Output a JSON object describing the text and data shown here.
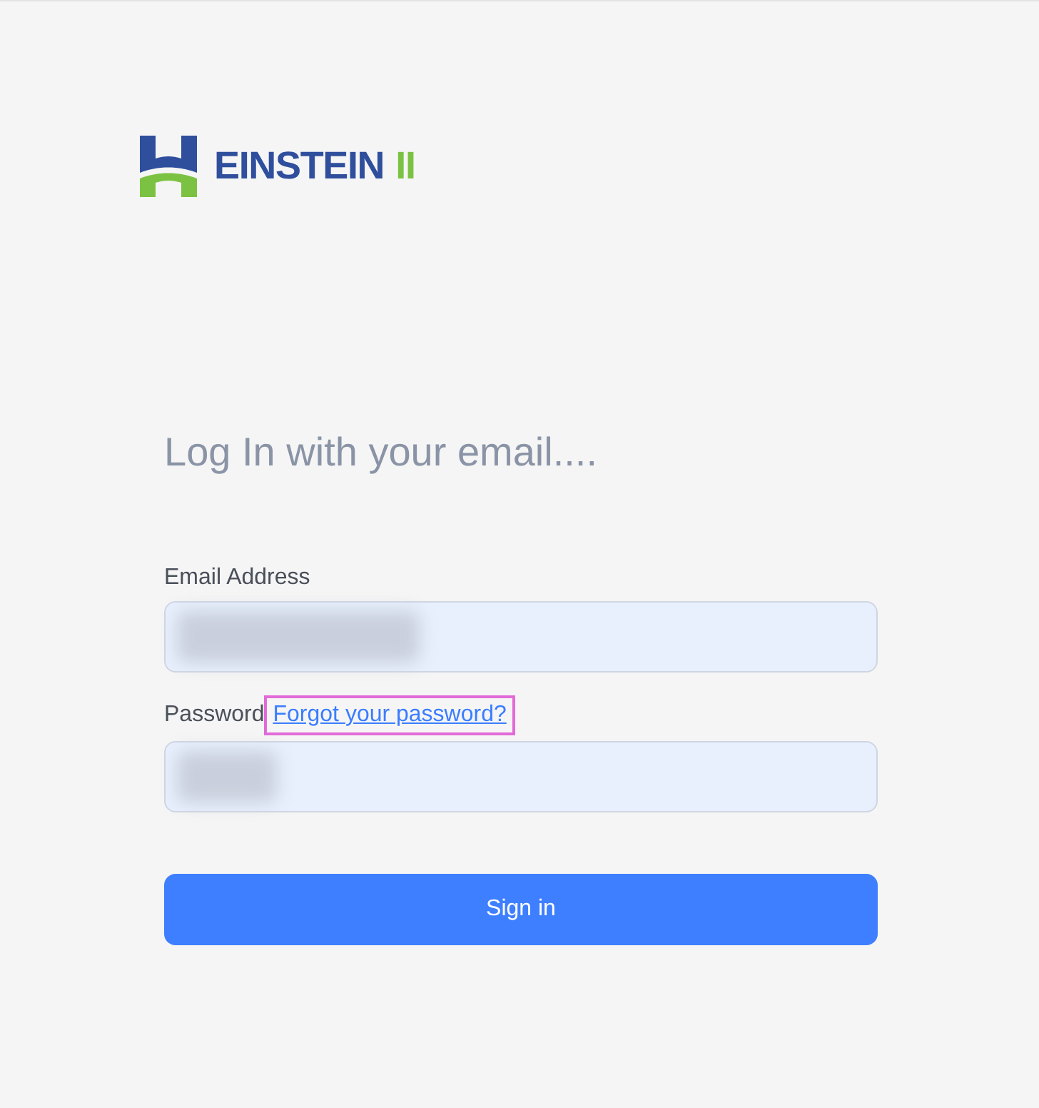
{
  "logo": {
    "name": "EINSTEIN",
    "suffix": "II"
  },
  "heading": "Log In with your email....",
  "fields": [
    {
      "label": "Email Address",
      "redacted": true
    },
    {
      "label": "Password",
      "redacted": true
    }
  ],
  "forgot_link": {
    "text": "Forgot your password?",
    "highlighted": true
  },
  "submit": "Sign in"
}
